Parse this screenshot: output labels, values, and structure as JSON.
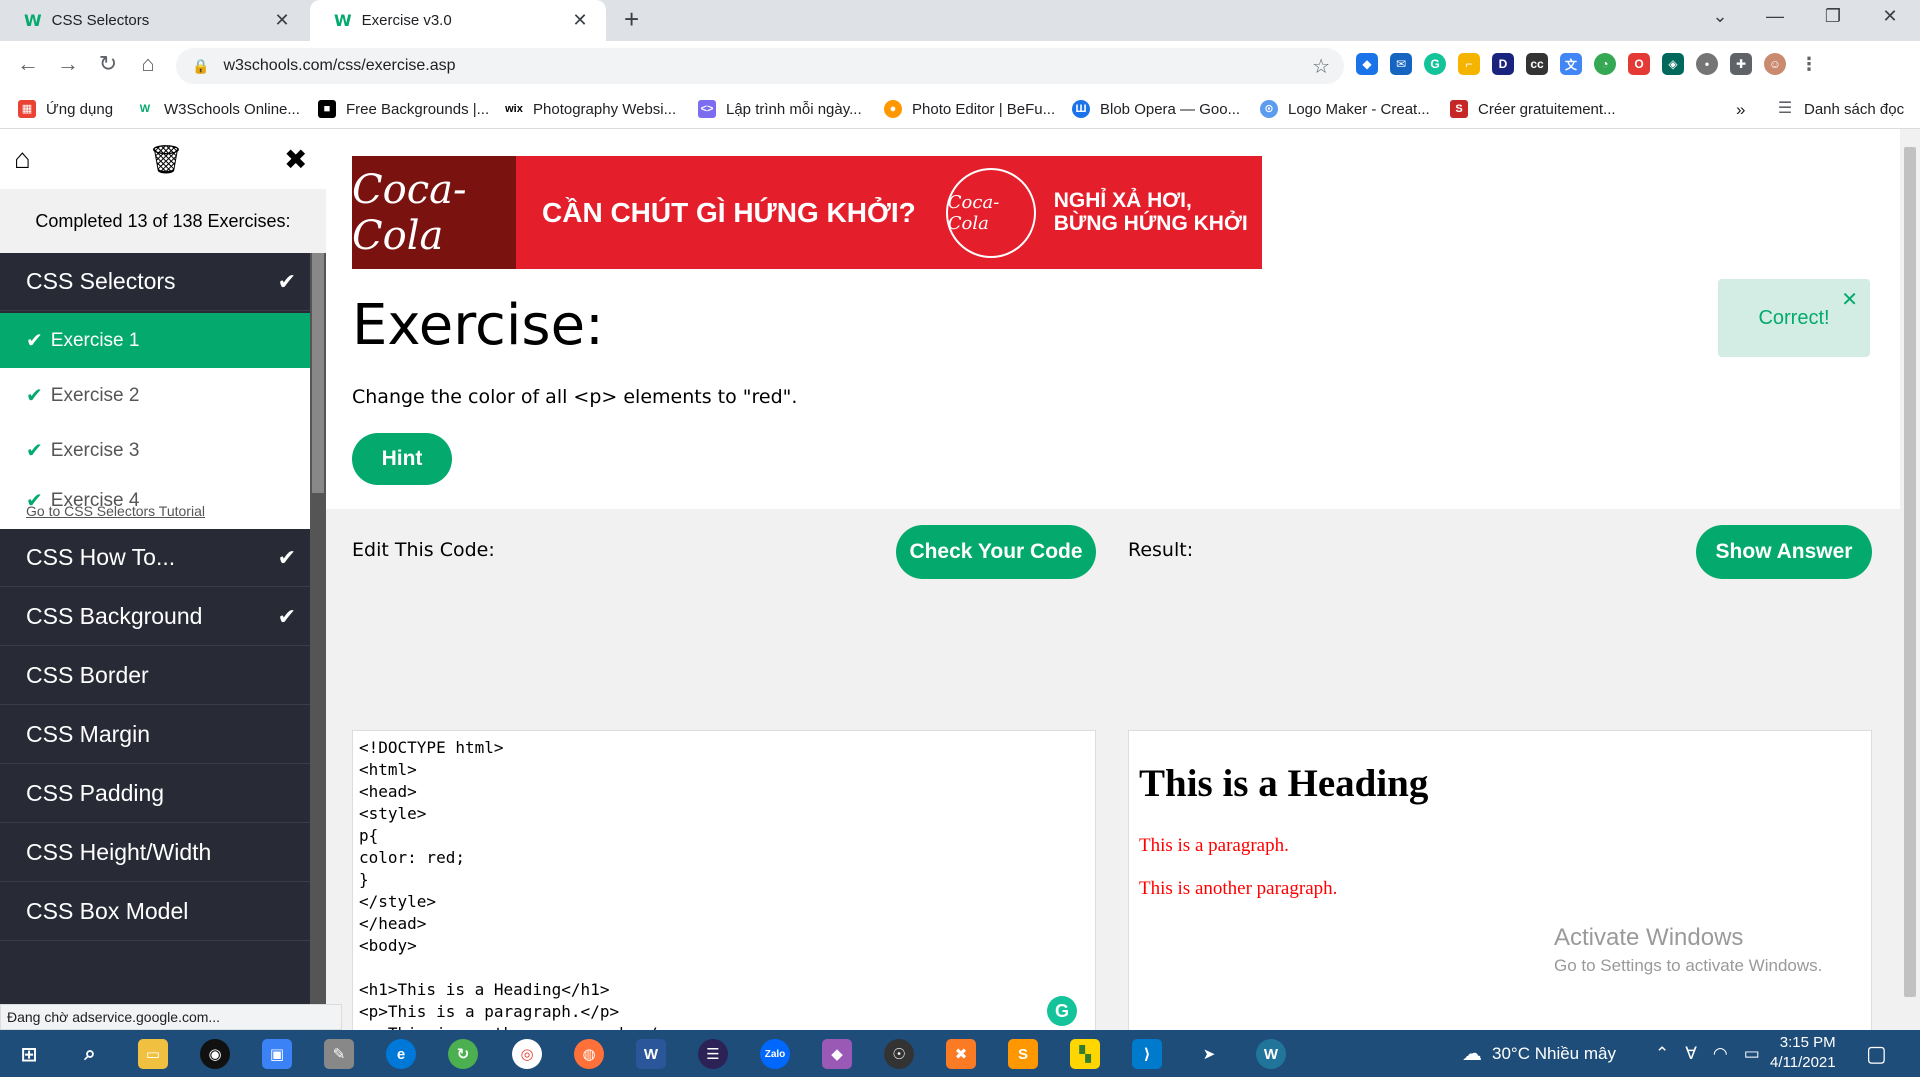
{
  "browser": {
    "tabs": [
      {
        "title": "CSS Selectors",
        "favicon": "W"
      },
      {
        "title": "Exercise v3.0",
        "favicon": "W"
      }
    ],
    "url": "w3schools.com/css/exercise.asp",
    "bookmarks": [
      "Ứng dụng",
      "W3Schools Online...",
      "Free Backgrounds |...",
      "Photography Websi...",
      "Lập trình mỗi ngày...",
      "Photo Editor | BeFu...",
      "Blob Opera — Goo...",
      "Logo Maker - Creat...",
      "Créer gratuitement..."
    ],
    "bookmarks_more": "»",
    "reading_list": "Danh sách đọc",
    "status_text": "Đang chờ adservice.google.com..."
  },
  "sidebar": {
    "progress": "Completed 13 of 138 Exercises:",
    "current_category": "CSS Selectors",
    "exercises": [
      "Exercise 1",
      "Exercise 2",
      "Exercise 3",
      "Exercise 4"
    ],
    "tutorial_link": "Go to CSS Selectors Tutorial",
    "categories": [
      {
        "label": "CSS How To...",
        "done": "✔"
      },
      {
        "label": "CSS Background",
        "done": "✔"
      },
      {
        "label": "CSS Border",
        "done": ""
      },
      {
        "label": "CSS Margin",
        "done": ""
      },
      {
        "label": "CSS Padding",
        "done": ""
      },
      {
        "label": "CSS Height/Width",
        "done": ""
      },
      {
        "label": "CSS Box Model",
        "done": ""
      }
    ]
  },
  "ad": {
    "brand": "Coca-Cola",
    "headline": "CẦN CHÚT GÌ HỨNG KHỞI?",
    "tagline_1": "NGHỈ XẢ HƠI,",
    "tagline_2": "BỪNG HỨNG KHỞI"
  },
  "exercise": {
    "title": "Exercise:",
    "description": "Change the color of all <p> elements to \"red\".",
    "hint_label": "Hint",
    "feedback": "Correct!",
    "edit_label": "Edit This Code:",
    "check_label": "Check Your Code",
    "result_label": "Result:",
    "show_answer_label": "Show Answer",
    "code": "<!DOCTYPE html>\n<html>\n<head>\n<style>\np{\ncolor: red;\n}\n</style>\n</head>\n<body>\n\n<h1>This is a Heading</h1>\n<p>This is a paragraph.</p>\n<p>This is another paragraph.</p>\n\n</body>\n</html>",
    "result": {
      "heading": "This is a Heading",
      "paragraph_1": "This is a paragraph.",
      "paragraph_2": "This is another paragraph."
    }
  },
  "watermark": {
    "line1": "Activate Windows",
    "line2": "Go to Settings to activate Windows."
  },
  "taskbar": {
    "weather": "30°C  Nhiều mây",
    "time": "3:15 PM",
    "date": "4/11/2021"
  },
  "colors": {
    "accent": "#04aa6d",
    "sidebar_bg": "#282a35",
    "result_text": "#ff0000"
  }
}
